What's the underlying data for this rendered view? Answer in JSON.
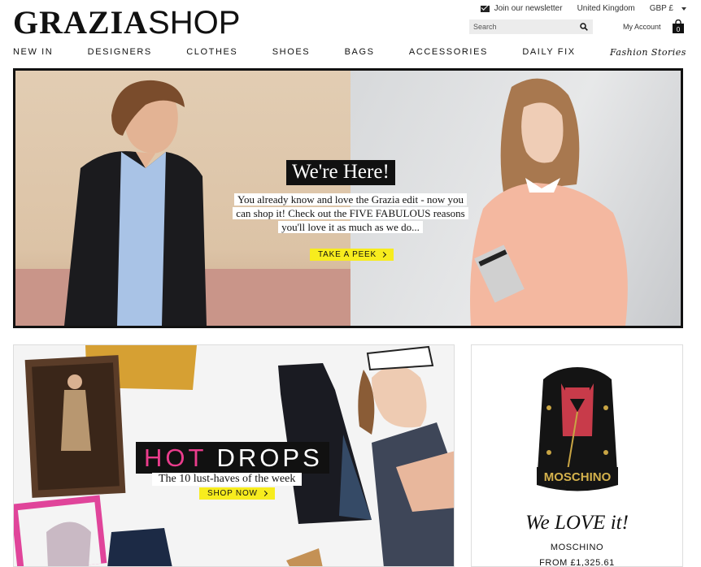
{
  "header": {
    "logo_bold": "GRAZIA",
    "logo_light": "SHOP",
    "newsletter": "Join our newsletter",
    "country": "United Kingdom",
    "currency": "GBP  £",
    "search_placeholder": "Search",
    "account": "My Account",
    "bag_count": "0"
  },
  "nav": {
    "items": [
      "NEW IN",
      "DESIGNERS",
      "CLOTHES",
      "SHOES",
      "BAGS",
      "ACCESSORIES",
      "DAILY FIX",
      "Fashion Stories"
    ]
  },
  "hero": {
    "title": "We're Here!",
    "description": "You already know and love the Grazia edit - now you can shop it! Check out the FIVE FABULOUS reasons you'll love it as much as we do...",
    "cta": "TAKE A PEEK"
  },
  "drops": {
    "title_hot": "HOT",
    "title_rest": "DROPS",
    "subtitle": "The 10 lust-haves of the week",
    "cta": "SHOP NOW"
  },
  "product": {
    "tagline": "We LOVE it!",
    "brand": "MOSCHINO",
    "price": "FROM £1,325.61",
    "bag_label": "MOSCHINO"
  },
  "colors": {
    "accent_yellow": "#f7ec1e",
    "hot_pink": "#ea3c8c",
    "black": "#111111"
  }
}
